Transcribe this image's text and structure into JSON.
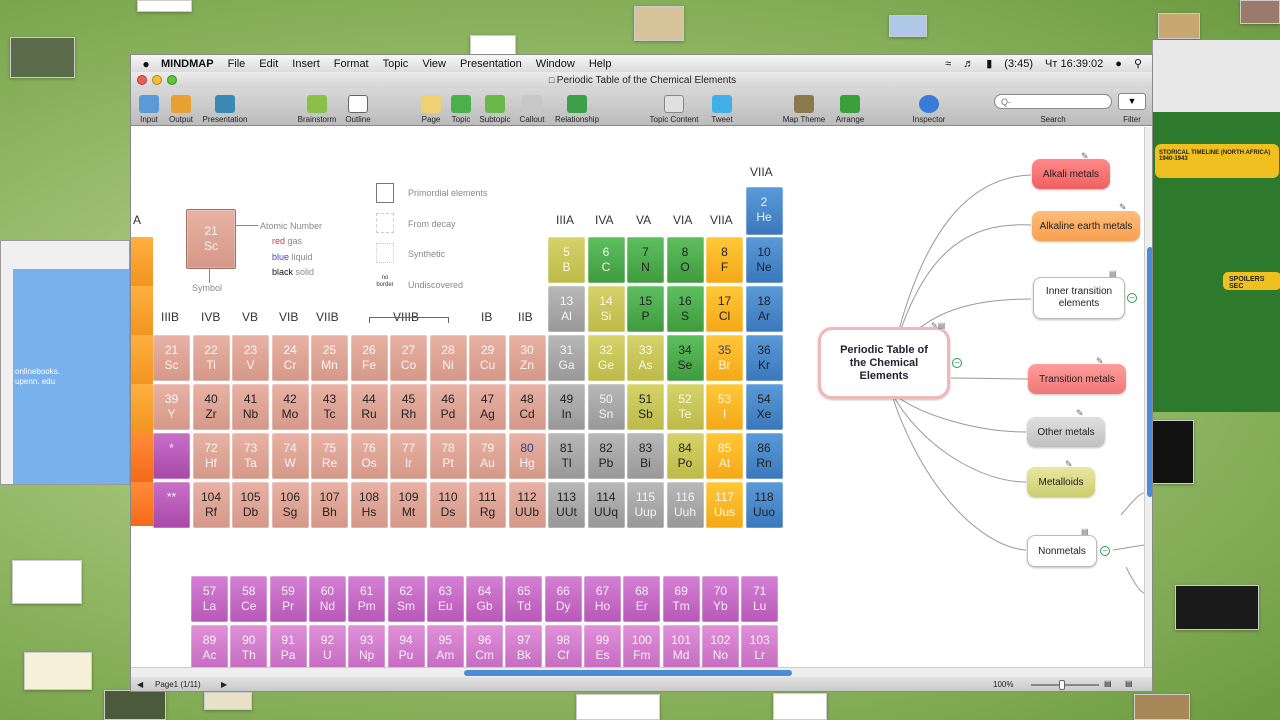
{
  "menubar": {
    "app": "MINDMAP",
    "items": [
      "File",
      "Edit",
      "Insert",
      "Format",
      "Topic",
      "View",
      "Presentation",
      "Window",
      "Help"
    ],
    "battery": "(3:45)",
    "clock": "Чт 16:39:02"
  },
  "window": {
    "title": "Periodic Table of the Chemical Elements"
  },
  "toolbar": {
    "input": "Input",
    "output": "Output",
    "presentation": "Presentation",
    "brainstorm": "Brainstorm",
    "outline": "Outline",
    "page": "Page",
    "topic": "Topic",
    "subtopic": "Subtopic",
    "callout": "Callout",
    "relationship": "Relationship",
    "topic_content": "Topic Content",
    "tweet": "Tweet",
    "map_theme": "Map Theme",
    "arrange": "Arrange",
    "inspector": "Inspector",
    "search": "Search",
    "filter": "Filter"
  },
  "search": {
    "placeholder": "Q-"
  },
  "legend": {
    "atomic_number": "Atomic Number",
    "red": "red",
    "gas": "gas",
    "blue": "blue",
    "liquid": "liquid",
    "black": "black",
    "solid": "solid",
    "symbol": "Symbol",
    "sample_num": "21",
    "sample_sym": "Sc",
    "primordial": "Primordial elements",
    "from_decay": "From decay",
    "synthetic": "Synthetic",
    "undiscovered": "Undiscovered",
    "no_border": "no border"
  },
  "groups": {
    "IIIA": "IIIA",
    "IVA": "IVA",
    "VA": "VA",
    "VIA": "VIA",
    "VIIA": "VIIA",
    "VIIA_top": "VIIA",
    "A": "A",
    "IIIB": "IIIB",
    "IVB": "IVB",
    "VB": "VB",
    "VIB": "VIB",
    "VIIB": "VIIB",
    "VIIIB": "VIIIB",
    "IB": "IB",
    "IIB": "IIB"
  },
  "elements": [
    [
      "2",
      "He",
      "noble",
      ""
    ],
    [
      "5",
      "B",
      "metalloid",
      ""
    ],
    [
      "6",
      "C",
      "nonmetal",
      ""
    ],
    [
      "7",
      "N",
      "nonmetal",
      "dark"
    ],
    [
      "8",
      "O",
      "nonmetal",
      "dark"
    ],
    [
      "8",
      "F",
      "halogen",
      "dark"
    ],
    [
      "10",
      "Ne",
      "noble",
      "dark"
    ],
    [
      "13",
      "Al",
      "poor",
      ""
    ],
    [
      "14",
      "Si",
      "metalloid",
      ""
    ],
    [
      "15",
      "P",
      "nonmetal",
      "dark"
    ],
    [
      "16",
      "S",
      "nonmetal",
      "dark"
    ],
    [
      "17",
      "Cl",
      "halogen",
      "dark"
    ],
    [
      "18",
      "Ar",
      "noble",
      "dark"
    ],
    [
      "21",
      "Sc",
      "trans",
      ""
    ],
    [
      "22",
      "Ti",
      "trans",
      ""
    ],
    [
      "23",
      "V",
      "trans",
      ""
    ],
    [
      "24",
      "Cr",
      "trans",
      ""
    ],
    [
      "25",
      "Mn",
      "trans",
      ""
    ],
    [
      "26",
      "Fe",
      "trans",
      ""
    ],
    [
      "27",
      "Co",
      "trans",
      ""
    ],
    [
      "28",
      "Ni",
      "trans",
      ""
    ],
    [
      "29",
      "Cu",
      "trans",
      ""
    ],
    [
      "30",
      "Zn",
      "trans",
      ""
    ],
    [
      "31",
      "Ga",
      "poor",
      ""
    ],
    [
      "32",
      "Ge",
      "metalloid",
      ""
    ],
    [
      "33",
      "As",
      "metalloid",
      ""
    ],
    [
      "34",
      "Se",
      "nonmetal",
      "dark"
    ],
    [
      "35",
      "Br",
      "halogen",
      "bluenum"
    ],
    [
      "36",
      "Kr",
      "noble",
      "dark"
    ],
    [
      "39",
      "Y",
      "trans",
      ""
    ],
    [
      "40",
      "Zr",
      "trans",
      "dark"
    ],
    [
      "41",
      "Nb",
      "trans",
      "dark"
    ],
    [
      "42",
      "Mo",
      "trans",
      "dark"
    ],
    [
      "43",
      "Tc",
      "trans",
      "dark"
    ],
    [
      "44",
      "Ru",
      "trans",
      "dark"
    ],
    [
      "45",
      "Rh",
      "trans",
      "dark"
    ],
    [
      "46",
      "Pd",
      "trans",
      "dark"
    ],
    [
      "47",
      "Ag",
      "trans",
      "dark"
    ],
    [
      "48",
      "Cd",
      "trans",
      "dark"
    ],
    [
      "49",
      "In",
      "poor",
      "dark"
    ],
    [
      "50",
      "Sn",
      "poor",
      ""
    ],
    [
      "51",
      "Sb",
      "metalloid",
      "dark"
    ],
    [
      "52",
      "Te",
      "metalloid",
      ""
    ],
    [
      "53",
      "I",
      "halogen",
      ""
    ],
    [
      "54",
      "Xe",
      "noble",
      "dark"
    ],
    [
      "*",
      "",
      "ph",
      ""
    ],
    [
      "72",
      "Hf",
      "trans",
      ""
    ],
    [
      "73",
      "Ta",
      "trans",
      ""
    ],
    [
      "74",
      "W",
      "trans",
      ""
    ],
    [
      "75",
      "Re",
      "trans",
      ""
    ],
    [
      "76",
      "Os",
      "trans",
      ""
    ],
    [
      "77",
      "Ir",
      "trans",
      ""
    ],
    [
      "78",
      "Pt",
      "trans",
      ""
    ],
    [
      "79",
      "Au",
      "trans",
      ""
    ],
    [
      "80",
      "Hg",
      "trans",
      "bluenum"
    ],
    [
      "81",
      "Tl",
      "poor",
      "dark"
    ],
    [
      "82",
      "Pb",
      "poor",
      "dark"
    ],
    [
      "83",
      "Bi",
      "poor",
      "dark"
    ],
    [
      "84",
      "Po",
      "metalloid",
      "dark"
    ],
    [
      "85",
      "At",
      "halogen",
      ""
    ],
    [
      "86",
      "Rn",
      "noble",
      "dark"
    ],
    [
      "**",
      "",
      "ph",
      ""
    ],
    [
      "104",
      "Rf",
      "trans",
      "dark"
    ],
    [
      "105",
      "Db",
      "trans",
      "dark"
    ],
    [
      "106",
      "Sg",
      "trans",
      "dark"
    ],
    [
      "107",
      "Bh",
      "trans",
      "dark"
    ],
    [
      "108",
      "Hs",
      "trans",
      "dark"
    ],
    [
      "109",
      "Mt",
      "trans",
      "dark"
    ],
    [
      "110",
      "Ds",
      "trans",
      "dark"
    ],
    [
      "111",
      "Rg",
      "trans",
      "dark"
    ],
    [
      "112",
      "UUb",
      "trans",
      "dark"
    ],
    [
      "113",
      "UUt",
      "poor",
      "dark"
    ],
    [
      "114",
      "UUq",
      "poor",
      "dark"
    ],
    [
      "115",
      "Uup",
      "poor",
      ""
    ],
    [
      "116",
      "Uuh",
      "poor",
      ""
    ],
    [
      "117",
      "Uus",
      "halogen",
      ""
    ],
    [
      "118",
      "Uuo",
      "noble",
      "dark"
    ],
    [
      "57",
      "La",
      "lan",
      ""
    ],
    [
      "58",
      "Ce",
      "lan",
      ""
    ],
    [
      "59",
      "Pr",
      "lan",
      ""
    ],
    [
      "60",
      "Nd",
      "lan",
      ""
    ],
    [
      "61",
      "Pm",
      "lan",
      ""
    ],
    [
      "62",
      "Sm",
      "lan",
      ""
    ],
    [
      "63",
      "Eu",
      "lan",
      ""
    ],
    [
      "64",
      "Gb",
      "lan",
      ""
    ],
    [
      "65",
      "Td",
      "lan",
      ""
    ],
    [
      "66",
      "Dy",
      "lan",
      ""
    ],
    [
      "67",
      "Ho",
      "lan",
      ""
    ],
    [
      "68",
      "Er",
      "lan",
      ""
    ],
    [
      "69",
      "Tm",
      "lan",
      ""
    ],
    [
      "70",
      "Yb",
      "lan",
      ""
    ],
    [
      "71",
      "Lu",
      "lan",
      ""
    ],
    [
      "89",
      "Ac",
      "act",
      ""
    ],
    [
      "90",
      "Th",
      "act",
      ""
    ],
    [
      "91",
      "Pa",
      "act",
      ""
    ],
    [
      "92",
      "U",
      "act",
      ""
    ],
    [
      "93",
      "Np",
      "act",
      ""
    ],
    [
      "94",
      "Pu",
      "act",
      ""
    ],
    [
      "95",
      "Am",
      "act",
      ""
    ],
    [
      "96",
      "Cm",
      "act",
      ""
    ],
    [
      "97",
      "Bk",
      "act",
      ""
    ],
    [
      "98",
      "Cf",
      "act",
      ""
    ],
    [
      "99",
      "Es",
      "act",
      ""
    ],
    [
      "100",
      "Fm",
      "act",
      ""
    ],
    [
      "101",
      "Md",
      "act",
      ""
    ],
    [
      "102",
      "No",
      "act",
      ""
    ],
    [
      "103",
      "Lr",
      "act",
      ""
    ]
  ],
  "mindmap": {
    "central": "Periodic Table of the Chemical Elements",
    "alkali": "Alkali metals",
    "alkaline_earth": "Alkaline earth metals",
    "inner_transition": "Inner transition elements",
    "transition": "Transition metals",
    "other": "Other metals",
    "metalloids": "Metalloids",
    "nonmetals": "Nonmetals"
  },
  "status": {
    "page": "Page1 (1/11)",
    "zoom": "100%"
  },
  "bg": {
    "left_text": "onlinebooks.\nupenn. edu",
    "right_title": "STORICAL TIMELINE (NORTH AFRICA) 1940-1943",
    "right_node": "SPOILERS SEC"
  },
  "colors": {
    "accent": "#4a8cd8",
    "toggle": "#2a9a50"
  }
}
